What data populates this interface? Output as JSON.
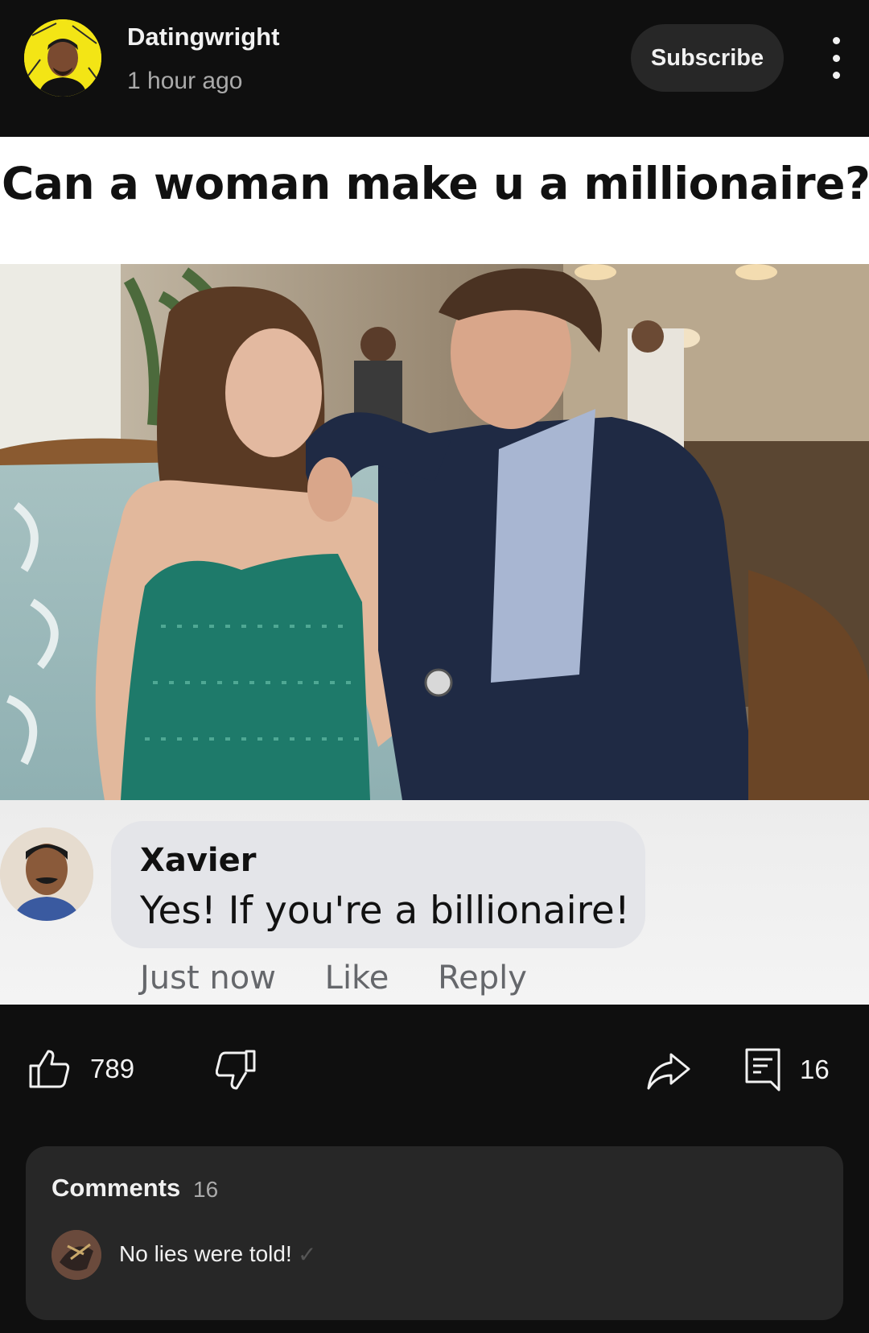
{
  "header": {
    "channel_name": "Datingwright",
    "timestamp": "1 hour ago",
    "subscribe_label": "Subscribe"
  },
  "post": {
    "caption": "Can a woman make u a millionaire?",
    "embedded_comment": {
      "name": "Xavier",
      "text": "Yes! If you're a billionaire!",
      "time": "Just now",
      "like_label": "Like",
      "reply_label": "Reply"
    }
  },
  "actions": {
    "like_count": "789",
    "comment_count": "16",
    "icons": [
      "thumbs-up-icon",
      "thumbs-down-icon",
      "share-icon",
      "comment-icon"
    ]
  },
  "comments": {
    "title": "Comments",
    "count": "16",
    "top_comment": "No lies were told!"
  },
  "colors": {
    "background": "#0f0f0f",
    "card": "#272727",
    "text": "#f1f1f1",
    "secondary_text": "#aaaaaa"
  }
}
